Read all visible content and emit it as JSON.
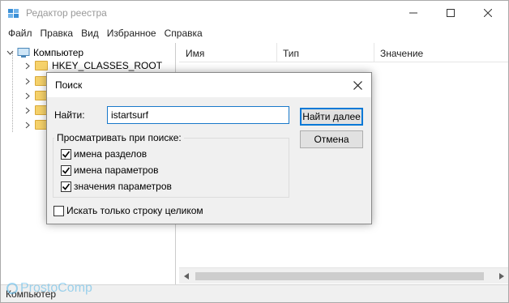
{
  "window": {
    "title": "Редактор реестра",
    "controls": {
      "minimize": "minimize",
      "maximize": "maximize",
      "close": "close"
    }
  },
  "menu": {
    "items": [
      {
        "label": "Файл"
      },
      {
        "label": "Правка"
      },
      {
        "label": "Вид"
      },
      {
        "label": "Избранное"
      },
      {
        "label": "Справка"
      }
    ]
  },
  "tree": {
    "root": {
      "label": "Компьютер",
      "icon": "computer-icon"
    },
    "children": [
      {
        "label": "HKEY_CLASSES_ROOT",
        "icon": "folder-icon"
      },
      {
        "label": "",
        "icon": "folder-icon"
      },
      {
        "label": "",
        "icon": "folder-icon"
      },
      {
        "label": "",
        "icon": "folder-icon"
      },
      {
        "label": "",
        "icon": "folder-icon"
      }
    ]
  },
  "list": {
    "columns": [
      {
        "label": "Имя"
      },
      {
        "label": "Тип"
      },
      {
        "label": "Значение"
      }
    ]
  },
  "status": {
    "text": "Компьютер"
  },
  "watermark": {
    "text": "ProstoComp",
    "color": "#55b6e8"
  },
  "dialog": {
    "title": "Поиск",
    "find_label": "Найти:",
    "find_value": "istartsurf",
    "find_next_button": "Найти далее",
    "cancel_button": "Отмена",
    "look_at_label": "Просматривать при поиске:",
    "options": [
      {
        "label": "имена разделов",
        "checked": true
      },
      {
        "label": "имена параметров",
        "checked": true
      },
      {
        "label": "значения параметров",
        "checked": true
      }
    ],
    "match_whole": {
      "label": "Искать только строку целиком",
      "checked": false
    }
  },
  "colors": {
    "accent": "#0078d7",
    "folder": "#f6d26b",
    "dialog_bg": "#f0f0f0"
  }
}
